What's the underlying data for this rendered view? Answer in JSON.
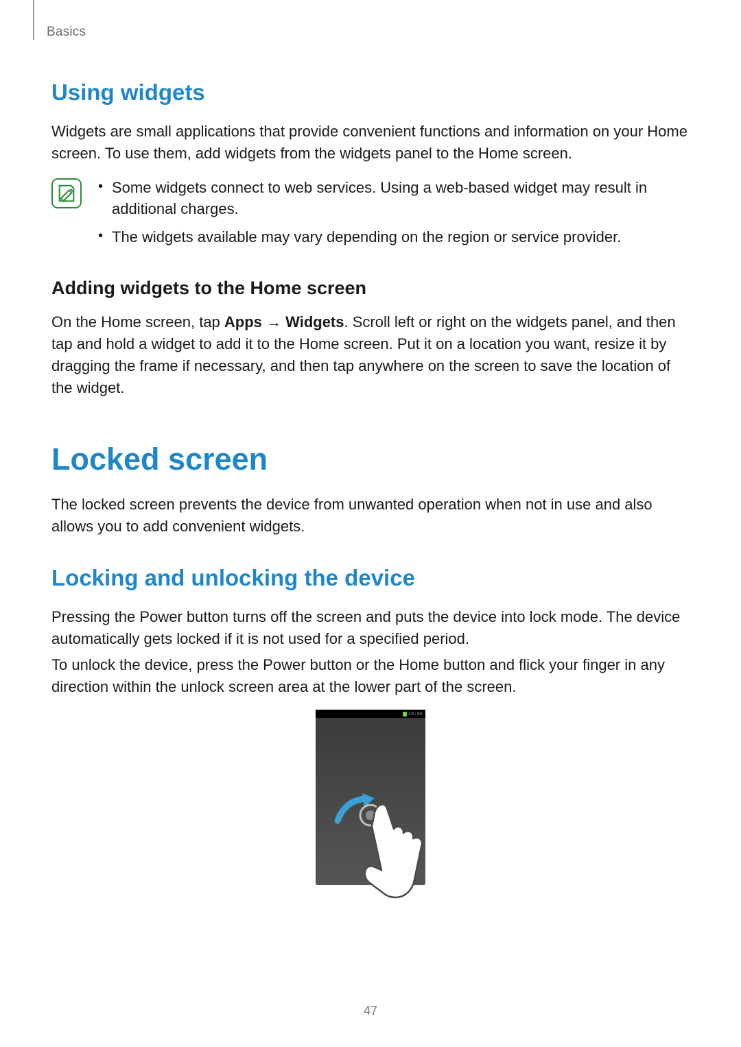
{
  "breadcrumb": "Basics",
  "section1": {
    "title": "Using widgets",
    "intro": "Widgets are small applications that provide convenient functions and information on your Home screen. To use them, add widgets from the widgets panel to the Home screen.",
    "notes": [
      "Some widgets connect to web services. Using a web-based widget may result in additional charges.",
      "The widgets available may vary depending on the region or service provider."
    ],
    "sub": {
      "title": "Adding widgets to the Home screen",
      "para_pre": "On the Home screen, tap ",
      "apps": "Apps",
      "arrow": " → ",
      "widgets": "Widgets",
      "para_post": ". Scroll left or right on the widgets panel, and then tap and hold a widget to add it to the Home screen. Put it on a location you want, resize it by dragging the frame if necessary, and then tap anywhere on the screen to save the location of the widget."
    }
  },
  "section2": {
    "title": "Locked screen",
    "intro": "The locked screen prevents the device from unwanted operation when not in use and also allows you to add convenient widgets."
  },
  "section3": {
    "title": "Locking and unlocking the device",
    "p1": "Pressing the Power button turns off the screen and puts the device into lock mode. The device automatically gets locked if it is not used for a specified period.",
    "p2": "To unlock the device, press the Power button or the Home button and flick your finger in any direction within the unlock screen area at the lower part of the screen."
  },
  "phone": {
    "time": "10:00"
  },
  "page_number": "47"
}
